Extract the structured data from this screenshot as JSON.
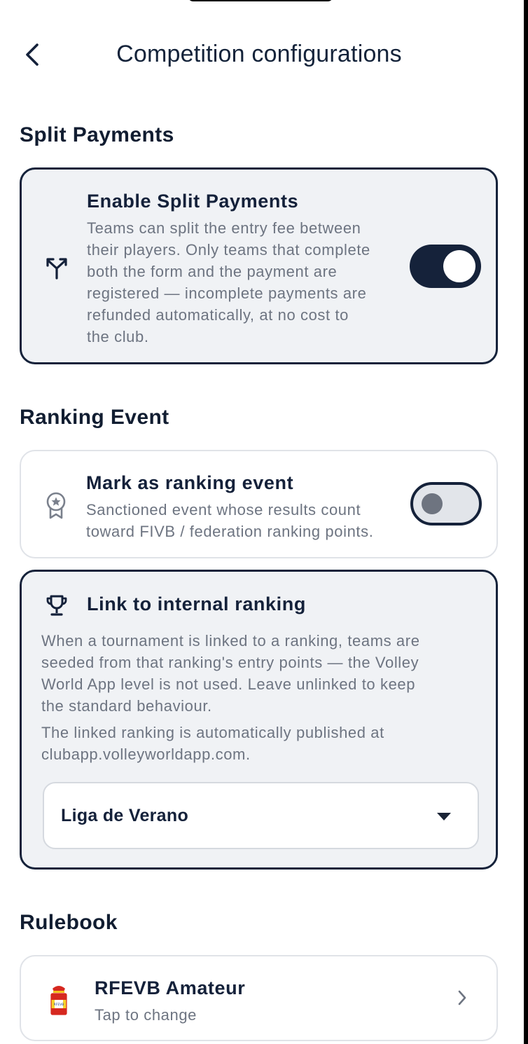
{
  "header": {
    "title": "Competition configurations",
    "back_icon": "chevron-left-icon"
  },
  "split_payments": {
    "section_title": "Split Payments",
    "title": "Enable Split Payments",
    "description_lines": [
      "Teams can split the entry fee between",
      "their players. Only teams that complete",
      "both the form and the payment are",
      "registered — incomplete payments are",
      "refunded automatically, at no cost to",
      "the club."
    ],
    "icon": "split-arrows-icon",
    "enabled": true
  },
  "ranking_event": {
    "section_title": "Ranking Event",
    "title": "Mark as ranking event",
    "description_lines": [
      "Sanctioned event whose results count",
      "toward FIVB / federation ranking points."
    ],
    "icon": "award-badge-icon",
    "enabled": false
  },
  "internal_ranking": {
    "title": "Link to internal ranking",
    "icon": "trophy-icon",
    "description_lines": [
      "When a tournament is linked to a ranking, teams are",
      "seeded from that ranking's entry points — the Volley",
      "World App level is not used. Leave unlinked to keep",
      "the standard behaviour."
    ],
    "note_lines": [
      "The linked ranking is automatically published at",
      "clubapp.volleyworldapp.com."
    ],
    "selected_ranking": "Liga de Verano"
  },
  "rulebook": {
    "section_title": "Rulebook",
    "name": "RFEVB Amateur",
    "subtitle": "Tap to change",
    "logo_text": "RFEVB"
  },
  "colors": {
    "primary": "#15223a",
    "card_background": "#f0f2f5",
    "muted_text": "#6d7481"
  }
}
